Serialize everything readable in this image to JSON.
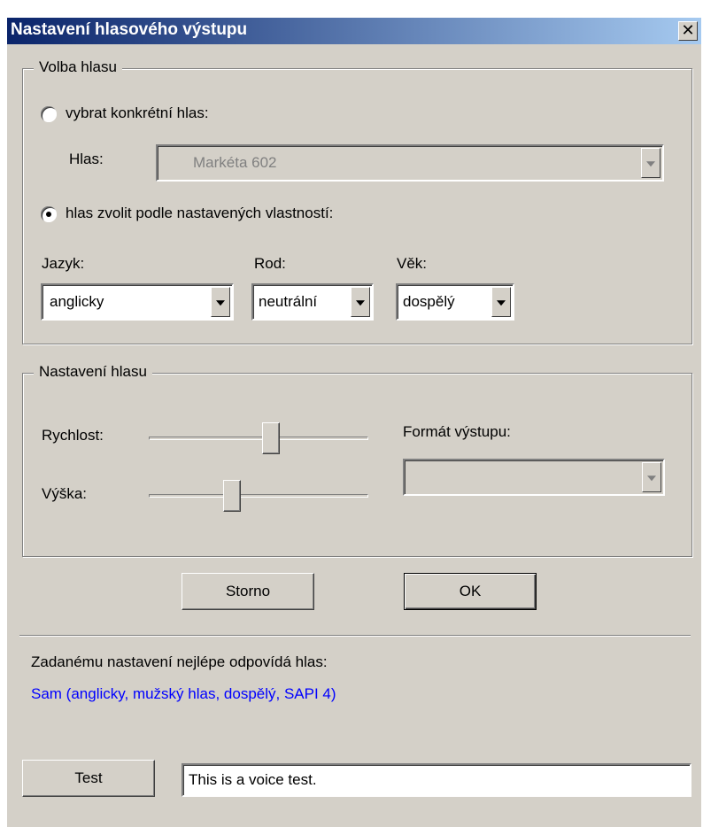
{
  "window": {
    "title": "Nastavení hlasového výstupu",
    "close_glyph": "✕"
  },
  "voice_selection": {
    "legend": "Volba hlasu",
    "specific_voice_radio_label": "vybrat konkrétní hlas:",
    "specific_voice_selected": false,
    "voice_label": "Hlas:",
    "voice_value": "Markéta 602",
    "by_properties_radio_label": "hlas zvolit podle nastavených vlastností:",
    "by_properties_selected": true,
    "language_label": "Jazyk:",
    "language_value": "anglicky",
    "gender_label": "Rod:",
    "gender_value": "neutrální",
    "age_label": "Věk:",
    "age_value": "dospělý"
  },
  "voice_settings": {
    "legend": "Nastavení hlasu",
    "speed_label": "Rychlost:",
    "speed_level": 0.56,
    "pitch_label": "Výška:",
    "pitch_level": 0.37,
    "output_format_label": "Formát výstupu:",
    "output_format_value": ""
  },
  "buttons": {
    "cancel_label": "Storno",
    "ok_label": "OK",
    "test_label": "Test"
  },
  "match": {
    "caption": "Zadanému nastavení nejlépe odpovídá hlas:",
    "voice": "Sam (anglicky, mužský hlas, dospělý, SAPI 4)"
  },
  "test_input": {
    "value": "This is a voice test."
  },
  "colors": {
    "titlebar_start": "#0a246a",
    "titlebar_end": "#a6caf0",
    "dialog_bg": "#d4d0c8",
    "match_text": "#0000ff"
  }
}
